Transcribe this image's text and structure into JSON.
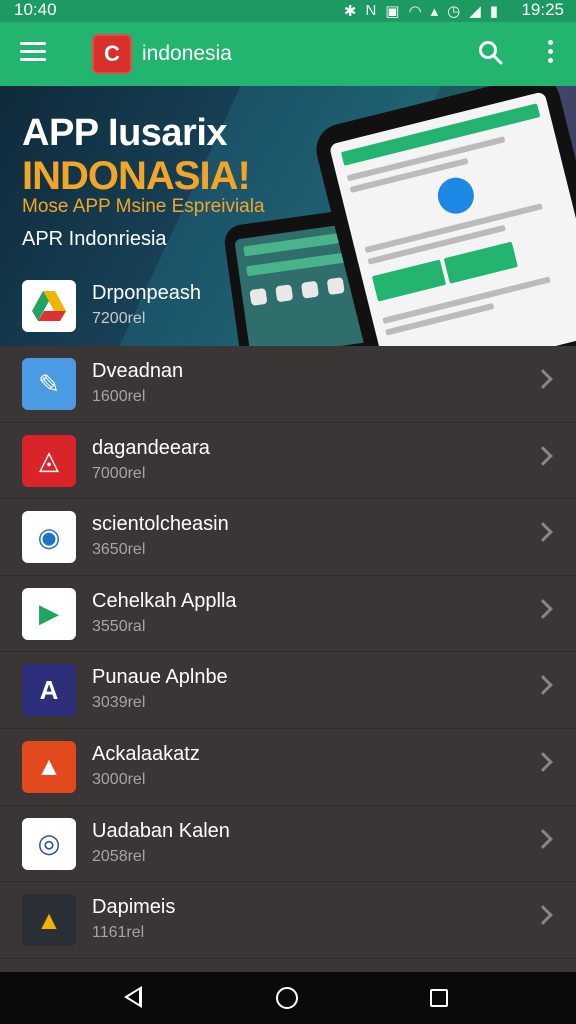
{
  "status_bar": {
    "time_left": "10:40",
    "time_right": "19:25"
  },
  "app_bar": {
    "title": "indonesia",
    "logo_letter": "C"
  },
  "banner": {
    "title": "APP Iusarix",
    "subtitle": "INDONASIA!",
    "tagline": "Mose APP Msine Espreiviala",
    "caption": "APR Indonriesia"
  },
  "featured": {
    "name": "Drponpeash",
    "size": "7200rel"
  },
  "apps": [
    {
      "name": "Dveadnan",
      "size": "1600rel",
      "icon_color": "#4b9be3",
      "icon": "wrench-icon",
      "glyph": "✎",
      "glyph_color": "#ffffff"
    },
    {
      "name": "dagandeeara",
      "size": "7000rel",
      "icon_color": "#d9252a",
      "icon": "triangle-logo-icon",
      "glyph": "◬",
      "glyph_color": "#ffffff"
    },
    {
      "name": "scientolcheasin",
      "size": "3650rel",
      "icon_color": "#ffffff",
      "icon": "sync-circle-icon",
      "glyph": "◉",
      "glyph_color": "#1e73c8"
    },
    {
      "name": "Cehelkah Applla",
      "size": "3550ral",
      "icon_color": "#ffffff",
      "icon": "play-store-icon",
      "glyph": "▶",
      "glyph_color": "#1fa463"
    },
    {
      "name": "Punaue Aplnbe",
      "size": "3039rel",
      "icon_color": "#2d2f7a",
      "icon": "letter-a-icon",
      "glyph": "A",
      "glyph_color": "#ffffff"
    },
    {
      "name": "Ackalaakatz",
      "size": "3000rel",
      "icon_color": "#e2491e",
      "icon": "mountain-logo-icon",
      "glyph": "▲",
      "glyph_color": "#ffffff"
    },
    {
      "name": "Uadaban Kalen",
      "size": "2058rel",
      "icon_color": "#ffffff",
      "icon": "camera-ring-icon",
      "glyph": "◎",
      "glyph_color": "#2a4fa5"
    },
    {
      "name": "Dapimeis",
      "size": "1161rel",
      "icon_color": "#2a2f36",
      "icon": "drive-triangle-icon",
      "glyph": "▲",
      "glyph_color": "#f2b400"
    }
  ],
  "colors": {
    "accent": "#23b46f",
    "status_bar": "#1c9a62",
    "list_bg": "#3a3636"
  }
}
